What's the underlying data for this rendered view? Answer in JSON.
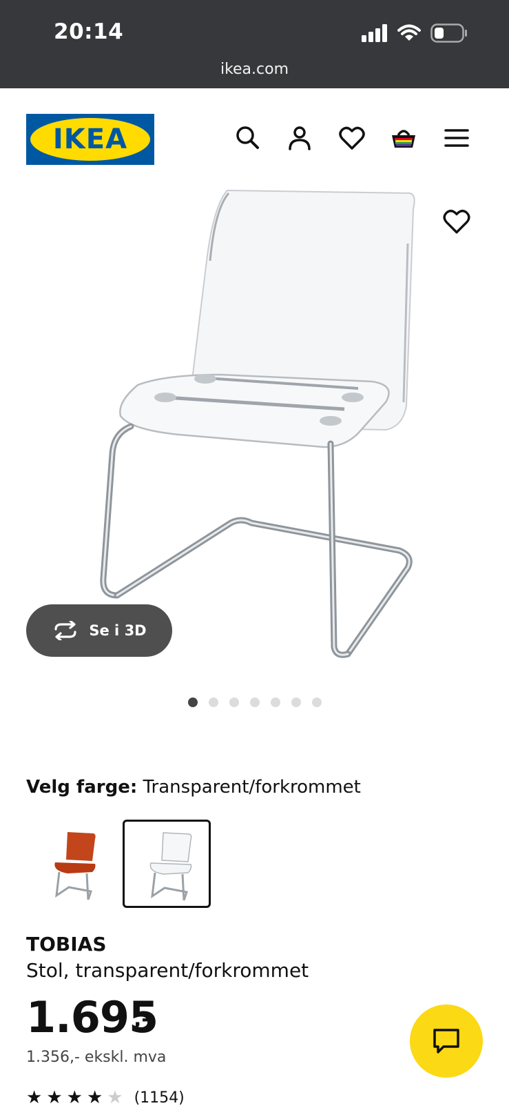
{
  "status_bar": {
    "time": "20:14",
    "url": "ikea.com",
    "icons": [
      "signal-icon",
      "wifi-icon",
      "battery-icon"
    ]
  },
  "header": {
    "logo_text": "IKEA",
    "icons": [
      "search-icon",
      "account-icon",
      "favorites-icon",
      "cart-icon",
      "menu-icon"
    ]
  },
  "gallery": {
    "view_3d_label": "Se i 3D",
    "image_count": 7,
    "active_index": 0
  },
  "color_picker": {
    "label": "Velg farge:",
    "selected_value": "Transparent/forkrommet",
    "options": [
      "brown-red",
      "transparent"
    ],
    "selected_index": 1
  },
  "product": {
    "name": "TOBIAS",
    "description": "Stol, transparent/forkrommet",
    "price": "1.695",
    "price_suffix": ",-",
    "price_ex_vat": "1.356,- ekskl. mva",
    "rating": 4,
    "rating_max": 5,
    "review_count": "(1154)"
  },
  "colors": {
    "ikea_blue": "#0058a3",
    "ikea_yellow": "#ffdb00",
    "chat_yellow": "#fbd914",
    "status_bar": "#36383b"
  }
}
